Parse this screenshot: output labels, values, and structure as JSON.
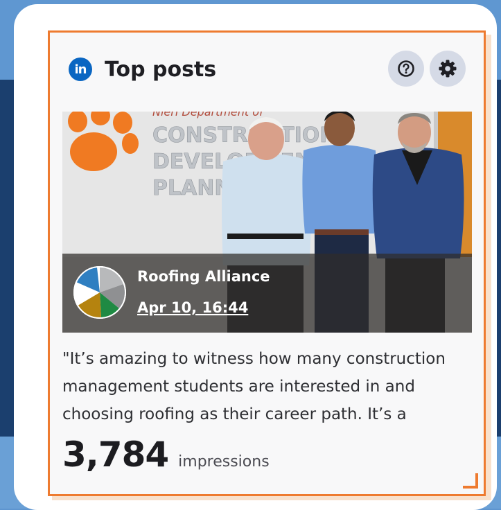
{
  "widget": {
    "title": "Top posts",
    "brand_icon": "linkedin-icon",
    "help_icon": "help-circle-icon",
    "settings_icon": "gear-icon"
  },
  "post": {
    "author": "Roofing Alliance",
    "timestamp": "Apr 10, 16:44",
    "caption": "\"It’s amazing to witness how many construction management students are interested in and choosing roofing as their career path. It’s a",
    "photo_sign_lines": [
      "CONSTRUCTION",
      "DEVELOPMENT",
      "PLANNING"
    ],
    "photo_sign_header": "Nieri Department of"
  },
  "metric": {
    "value": "3,784",
    "label": "impressions"
  },
  "colors": {
    "accent": "#ee7b30",
    "linkedin": "#0a66c2"
  }
}
